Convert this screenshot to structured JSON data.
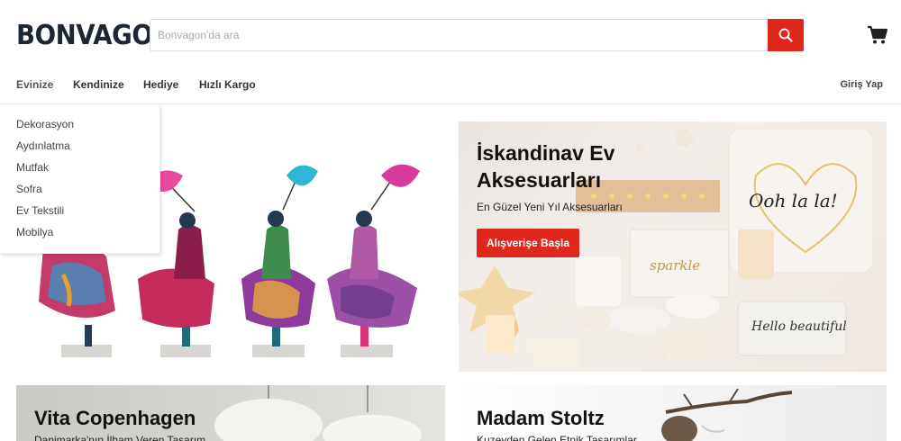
{
  "header": {
    "logo": "BONVAGON",
    "search_placeholder": "Bonvagon'da ara"
  },
  "nav": {
    "items": [
      "Evinize",
      "Kendinize",
      "Hediye",
      "Hızlı Kargo"
    ],
    "login": "Giriş Yap"
  },
  "dropdown": {
    "items": [
      "Dekorasyon",
      "Aydınlatma",
      "Mutfak",
      "Sofra",
      "Ev Tekstili",
      "Mobilya"
    ]
  },
  "banners": {
    "scandi": {
      "title_line1": "İskandinav Ev",
      "title_line2": "Aksesuarları",
      "subtitle": "En Güzel Yeni Yıl Aksesuarları",
      "cta": "Alışverişe Başla",
      "pillow_text": "Ooh la la!",
      "pouch_text": "sparkle",
      "bag_text": "Hello beautiful"
    },
    "vita": {
      "title": "Vita Copenhagen",
      "subtitle": "Danimarka'nın İlham Veren Tasarım"
    },
    "madam": {
      "title": "Madam Stoltz",
      "subtitle": "Kuzeyden Gelen Etnik Tasarımlar"
    }
  },
  "colors": {
    "accent": "#e0271b",
    "logo": "#1c2733"
  },
  "icons": {
    "search": "search-icon",
    "cart": "cart-icon"
  }
}
